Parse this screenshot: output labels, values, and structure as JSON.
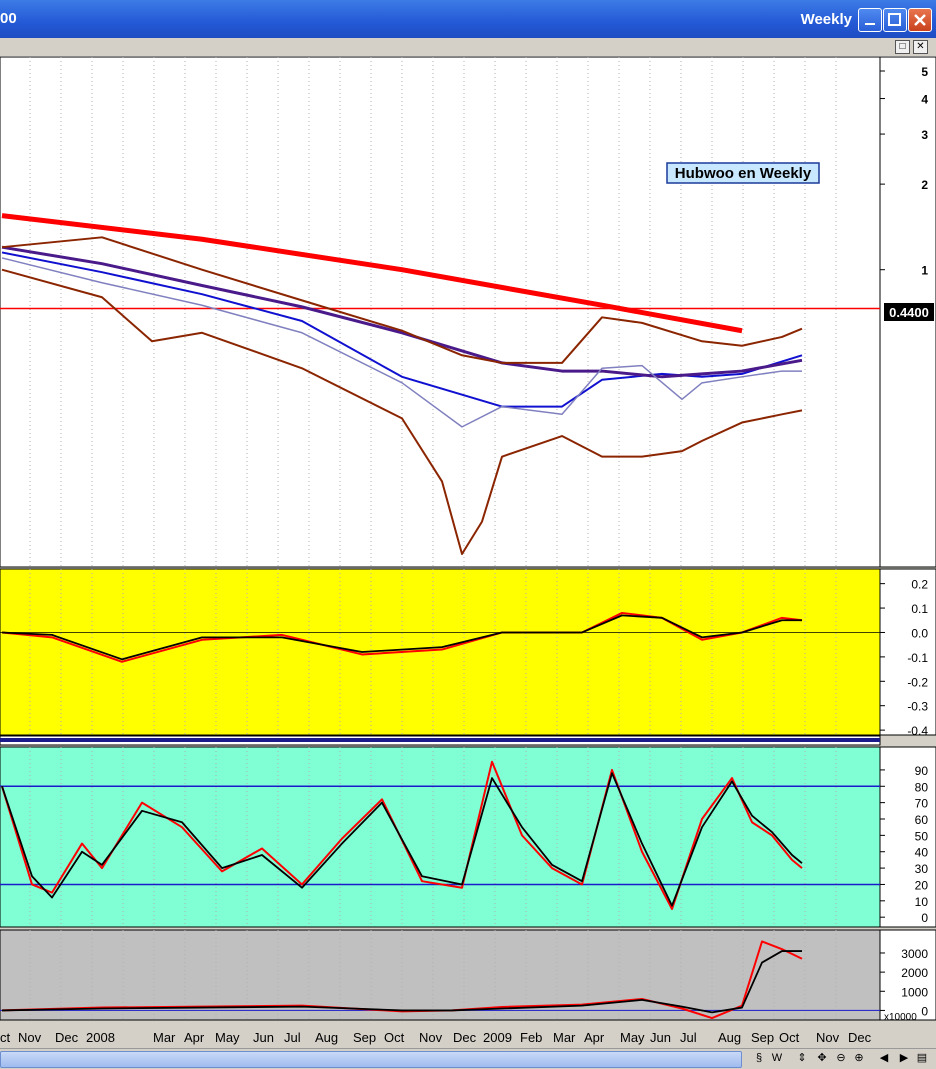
{
  "window": {
    "title": "Weekly",
    "left_fragment": "00",
    "minimize_icon": "minimize-icon",
    "maximize_icon": "maximize-icon",
    "close_icon": "close-icon"
  },
  "chart_data": {
    "type": "line",
    "title": "Hubwoo en Weekly",
    "price_label": "0.4400",
    "x_labels": [
      "ct",
      "Nov",
      "Dec",
      "2008",
      "Mar",
      "Apr",
      "May",
      "Jun",
      "Jul",
      "Aug",
      "Sep",
      "Oct",
      "Nov",
      "Dec",
      "2009",
      "Feb",
      "Mar",
      "Apr",
      "May",
      "Jun",
      "Jul",
      "Aug",
      "Sep",
      "Oct",
      "Nov",
      "Dec"
    ],
    "price_panel": {
      "y_ticks": [
        "5",
        "4",
        "3",
        "2",
        "1"
      ],
      "horizontal_line": 0.73,
      "series": [
        {
          "color": "#ff0000",
          "x": [
            0,
            20,
            40,
            60,
            74
          ],
          "y": [
            1.55,
            1.28,
            1.0,
            0.75,
            0.61
          ]
        },
        {
          "color": "#1010d0",
          "x": [
            0,
            10,
            20,
            30,
            40,
            50,
            56,
            60,
            66,
            70,
            74,
            80
          ],
          "y": [
            1.15,
            0.98,
            0.82,
            0.66,
            0.42,
            0.33,
            0.33,
            0.41,
            0.43,
            0.42,
            0.43,
            0.5
          ]
        },
        {
          "color": "#4a1a8a",
          "x": [
            0,
            10,
            20,
            30,
            40,
            50,
            56,
            60,
            66,
            70,
            74,
            80
          ],
          "y": [
            1.2,
            1.05,
            0.88,
            0.74,
            0.6,
            0.47,
            0.44,
            0.44,
            0.42,
            0.43,
            0.44,
            0.48
          ]
        },
        {
          "color": "#8b2500",
          "x": [
            0,
            10,
            20,
            30,
            40,
            46,
            50,
            56,
            60,
            64,
            70,
            74,
            78,
            80
          ],
          "y": [
            1.2,
            1.3,
            1.0,
            0.78,
            0.61,
            0.5,
            0.47,
            0.47,
            0.68,
            0.65,
            0.56,
            0.54,
            0.58,
            0.62
          ]
        },
        {
          "color": "#8b2500",
          "x": [
            0,
            10,
            15,
            20,
            30,
            40,
            44,
            46,
            48,
            50,
            56,
            60,
            64,
            68,
            70,
            74,
            78,
            80
          ],
          "y": [
            1.0,
            0.8,
            0.56,
            0.6,
            0.45,
            0.3,
            0.18,
            0.1,
            0.13,
            0.22,
            0.26,
            0.22,
            0.22,
            0.23,
            0.25,
            0.29,
            0.31,
            0.32
          ]
        },
        {
          "color": "#8080c0",
          "x": [
            0,
            10,
            20,
            30,
            40,
            46,
            50,
            56,
            60,
            64,
            68,
            70,
            74,
            78,
            80
          ],
          "y": [
            1.1,
            0.9,
            0.75,
            0.6,
            0.4,
            0.28,
            0.33,
            0.31,
            0.45,
            0.46,
            0.35,
            0.4,
            0.42,
            0.44,
            0.44
          ]
        }
      ]
    },
    "macd_panel": {
      "y_ticks": [
        "0.2",
        "0.1",
        "0.0",
        "-0.1",
        "-0.2",
        "-0.3",
        "-0.4"
      ],
      "series": [
        {
          "color": "#ff0000",
          "x": [
            0,
            5,
            12,
            20,
            28,
            36,
            44,
            50,
            58,
            62,
            66,
            70,
            74,
            78,
            80
          ],
          "y": [
            0.0,
            -0.02,
            -0.12,
            -0.03,
            -0.01,
            -0.09,
            -0.07,
            0.0,
            0.0,
            0.08,
            0.06,
            -0.03,
            0.0,
            0.06,
            0.05
          ]
        },
        {
          "color": "#000000",
          "x": [
            0,
            5,
            12,
            20,
            28,
            36,
            44,
            50,
            58,
            62,
            66,
            70,
            74,
            78,
            80
          ],
          "y": [
            0.0,
            -0.01,
            -0.11,
            -0.02,
            -0.02,
            -0.08,
            -0.06,
            0.0,
            0.0,
            0.07,
            0.06,
            -0.02,
            0.0,
            0.05,
            0.05
          ]
        }
      ]
    },
    "stoch_panel": {
      "y_ticks": [
        "90",
        "80",
        "70",
        "60",
        "50",
        "40",
        "30",
        "20",
        "10",
        "0"
      ],
      "lines": [
        80,
        20
      ],
      "series": [
        {
          "color": "#ff0000",
          "x": [
            0,
            3,
            5,
            8,
            10,
            14,
            18,
            22,
            26,
            30,
            34,
            38,
            42,
            46,
            49,
            52,
            55,
            58,
            61,
            64,
            67,
            70,
            73,
            75,
            77,
            79,
            80
          ],
          "y": [
            80,
            20,
            15,
            45,
            30,
            70,
            55,
            28,
            42,
            20,
            48,
            72,
            22,
            18,
            95,
            50,
            30,
            20,
            90,
            40,
            5,
            60,
            85,
            58,
            50,
            35,
            30
          ]
        },
        {
          "color": "#000000",
          "x": [
            0,
            3,
            5,
            8,
            10,
            14,
            18,
            22,
            26,
            30,
            34,
            38,
            42,
            46,
            49,
            52,
            55,
            58,
            61,
            64,
            67,
            70,
            73,
            75,
            77,
            79,
            80
          ],
          "y": [
            80,
            25,
            12,
            40,
            32,
            65,
            58,
            30,
            38,
            18,
            45,
            70,
            25,
            20,
            85,
            55,
            32,
            22,
            88,
            45,
            7,
            55,
            83,
            62,
            52,
            38,
            33
          ]
        }
      ]
    },
    "volume_panel": {
      "y_ticks": [
        "3000",
        "2000",
        "1000",
        "0"
      ],
      "scale_label": "x10000",
      "series": [
        {
          "color": "#ff0000",
          "x": [
            0,
            10,
            20,
            30,
            40,
            45,
            50,
            58,
            64,
            68,
            71,
            74,
            76,
            78,
            80
          ],
          "y": [
            0,
            150,
            200,
            250,
            -50,
            0,
            180,
            300,
            600,
            100,
            -400,
            250,
            3600,
            3200,
            2700
          ]
        },
        {
          "color": "#000000",
          "x": [
            0,
            10,
            20,
            30,
            40,
            45,
            50,
            58,
            64,
            68,
            71,
            74,
            76,
            78,
            80
          ],
          "y": [
            0,
            100,
            150,
            200,
            0,
            0,
            100,
            250,
            550,
            200,
            -100,
            150,
            2500,
            3100,
            3100
          ]
        }
      ]
    }
  },
  "scrollbar": {
    "icons": [
      "trend-icon",
      "weekly-icon",
      "scroll-vert-icon",
      "pan-icon",
      "zoom-out-icon",
      "zoom-in-icon",
      "prev-icon",
      "next-icon",
      "panel-icon"
    ],
    "w_label": "W"
  }
}
